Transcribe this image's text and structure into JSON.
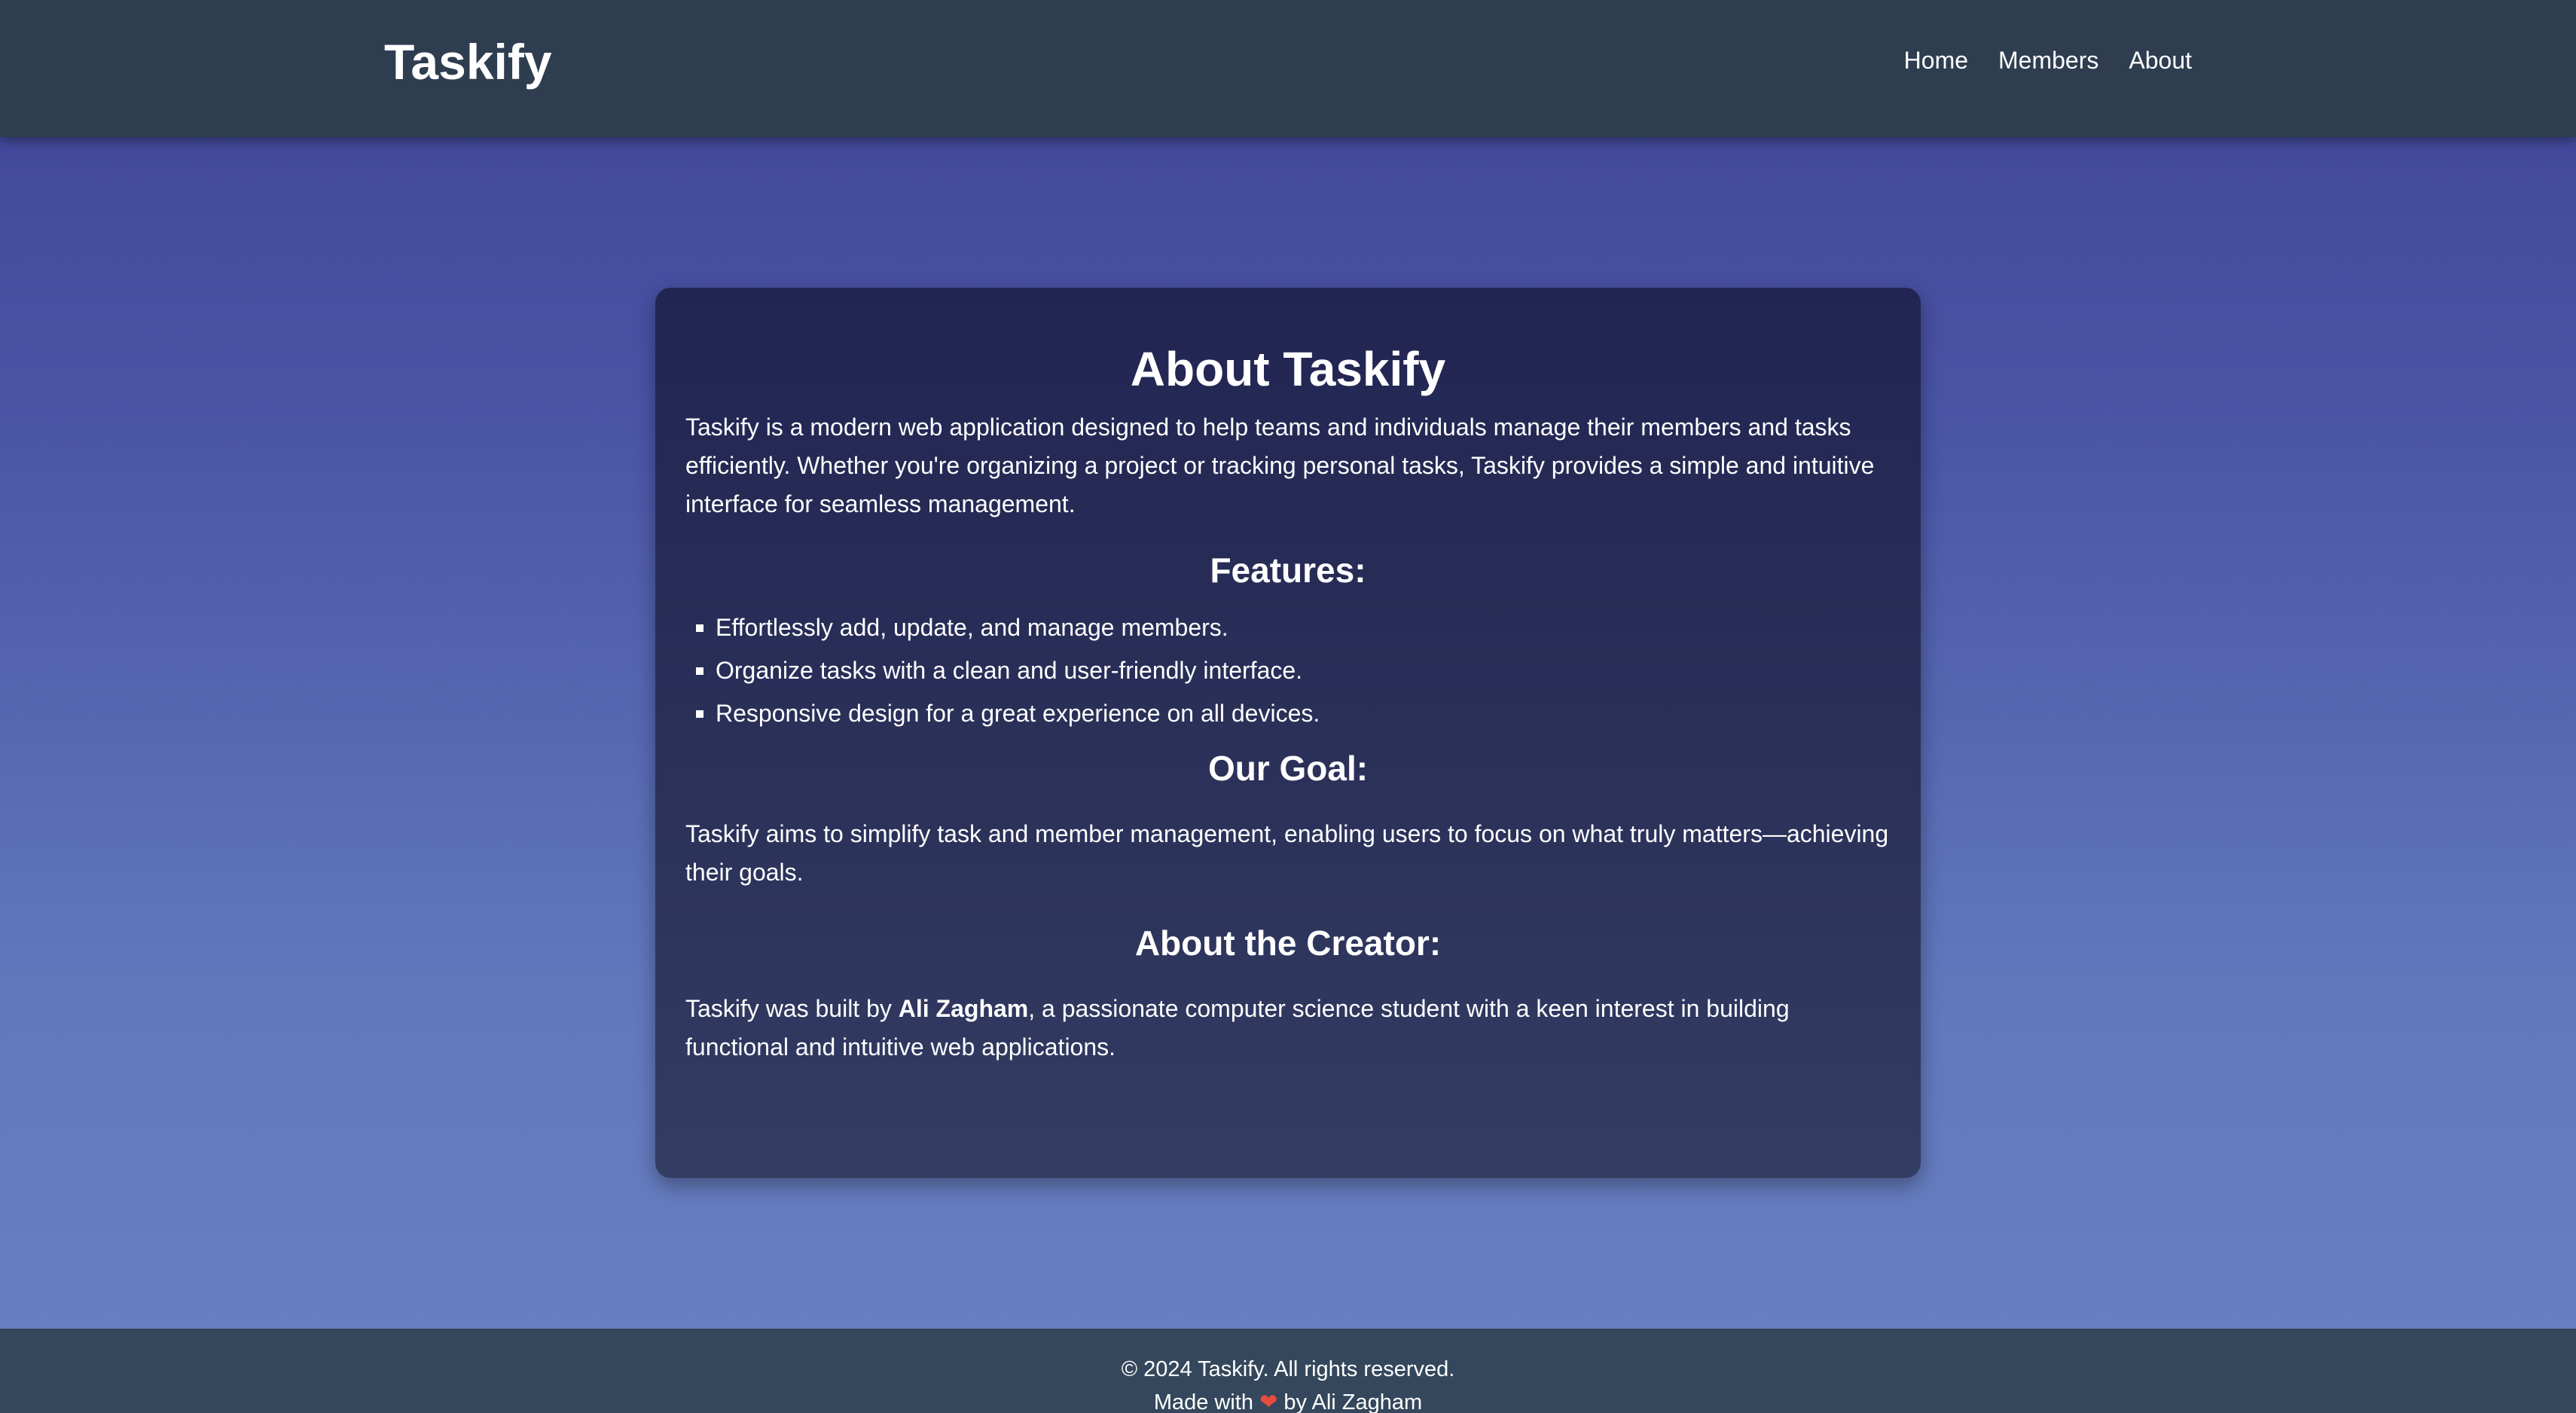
{
  "header": {
    "brand": "Taskify",
    "nav": [
      "Home",
      "Members",
      "About"
    ]
  },
  "about": {
    "title": "About Taskify",
    "intro": "Taskify is a modern web application designed to help teams and individuals manage their members and tasks efficiently. Whether you're organizing a project or tracking personal tasks, Taskify provides a simple and intuitive interface for seamless management.",
    "features_heading": "Features:",
    "features": [
      "Effortlessly add, update, and manage members.",
      "Organize tasks with a clean and user-friendly interface.",
      "Responsive design for a great experience on all devices."
    ],
    "goal_heading": "Our Goal:",
    "goal_text": "Taskify aims to simplify task and member management, enabling users to focus on what truly matters—achieving their goals.",
    "creator_heading": "About the Creator:",
    "creator_prefix": "Taskify was built by ",
    "creator_name": "Ali Zagham",
    "creator_suffix": ", a passionate computer science student with a keen interest in building functional and intuitive web applications."
  },
  "footer": {
    "copyright": "© 2024 Taskify. All rights reserved.",
    "made_with_prefix": "Made with",
    "heart_icon": "heart-icon",
    "made_with_suffix": "by Ali Zagham"
  },
  "colors": {
    "header_bg": "#2f3d50",
    "footer_bg": "#34475c",
    "card_bg": "#2b3159",
    "page_gradient_top": "#3f4496",
    "page_gradient_bottom": "#6a80c2",
    "heart": "#e74c3c"
  }
}
